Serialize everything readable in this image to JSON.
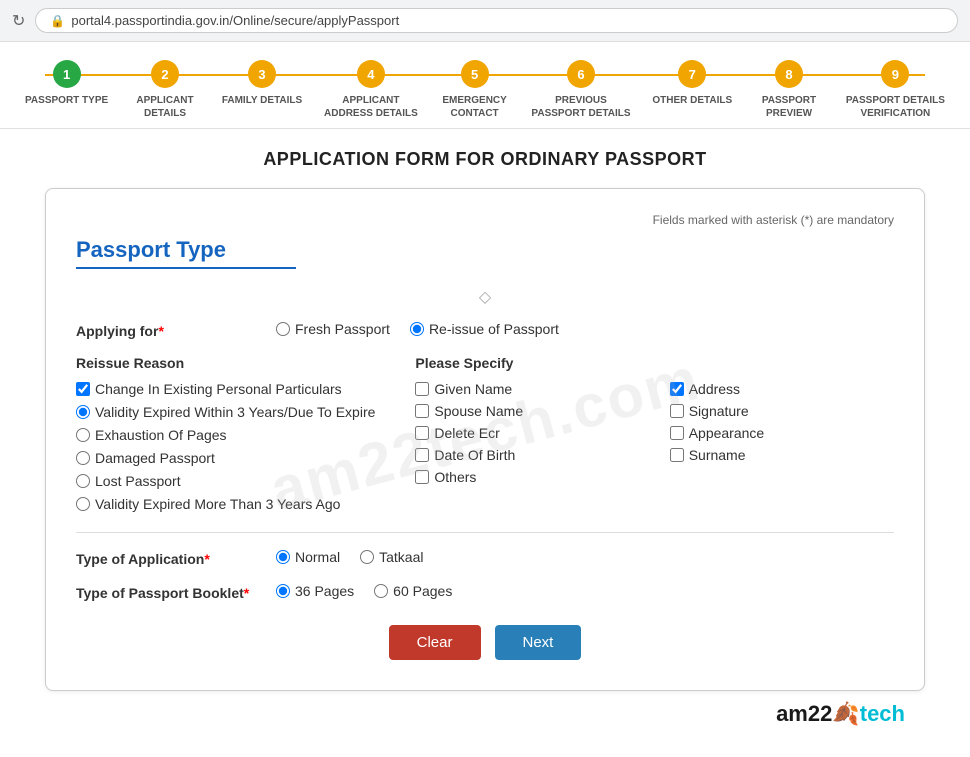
{
  "browser": {
    "url": "portal4.passportindia.gov.in/Online/secure/applyPassport"
  },
  "steps": [
    {
      "number": "1",
      "label": "PASSPORT TYPE",
      "state": "active"
    },
    {
      "number": "2",
      "label": "APPLICANT\nDETAILS",
      "state": "inactive"
    },
    {
      "number": "3",
      "label": "FAMILY DETAILS",
      "state": "inactive"
    },
    {
      "number": "4",
      "label": "APPLICANT\nADDRESS DETAILS",
      "state": "inactive"
    },
    {
      "number": "5",
      "label": "EMERGENCY\nCONTACT",
      "state": "inactive"
    },
    {
      "number": "6",
      "label": "PREVIOUS\nPASSPORT DETAILS",
      "state": "inactive"
    },
    {
      "number": "7",
      "label": "OTHER DETAILS",
      "state": "inactive"
    },
    {
      "number": "8",
      "label": "PASSPORT\nPREVIEW",
      "state": "inactive"
    },
    {
      "number": "9",
      "label": "PASSPORT DETAILS\nVERIFICATION",
      "state": "inactive"
    }
  ],
  "page_title": "APPLICATION FORM FOR ORDINARY PASSPORT",
  "mandatory_note": "Fields marked with asterisk (*) are mandatory",
  "section_title": "Passport Type",
  "applying_for_label": "Applying for",
  "applying_for_options": [
    {
      "label": "Fresh Passport",
      "value": "fresh",
      "checked": false
    },
    {
      "label": "Re-issue of Passport",
      "value": "reissue",
      "checked": true
    }
  ],
  "reissue_reason_title": "Reissue Reason",
  "reissue_reasons": [
    {
      "label": "Change In Existing Personal Particulars",
      "type": "checkbox",
      "checked": true
    },
    {
      "label": "Validity Expired Within 3 Years/Due To Expire",
      "type": "radio",
      "checked": true
    },
    {
      "label": "Exhaustion Of Pages",
      "type": "radio",
      "checked": false
    },
    {
      "label": "Damaged Passport",
      "type": "radio",
      "checked": false
    },
    {
      "label": "Lost Passport",
      "type": "radio",
      "checked": false
    },
    {
      "label": "Validity Expired More Than 3 Years Ago",
      "type": "radio",
      "checked": false
    }
  ],
  "please_specify_title": "Please Specify",
  "please_specify_items": [
    {
      "label": "Given Name",
      "checked": false,
      "col": 1
    },
    {
      "label": "Address",
      "checked": true,
      "col": 2
    },
    {
      "label": "Spouse Name",
      "checked": false,
      "col": 1
    },
    {
      "label": "Signature",
      "checked": false,
      "col": 2
    },
    {
      "label": "Delete Ecr",
      "checked": false,
      "col": 1
    },
    {
      "label": "Appearance",
      "checked": false,
      "col": 2
    },
    {
      "label": "Date Of Birth",
      "checked": false,
      "col": 1
    },
    {
      "label": "Surname",
      "checked": false,
      "col": 2
    },
    {
      "label": "Others",
      "checked": false,
      "col": 1
    }
  ],
  "type_of_application_label": "Type of Application",
  "application_type_options": [
    {
      "label": "Normal",
      "checked": true
    },
    {
      "label": "Tatkaal",
      "checked": false
    }
  ],
  "type_of_booklet_label": "Type of Passport Booklet",
  "booklet_options": [
    {
      "label": "36 Pages",
      "checked": true
    },
    {
      "label": "60 Pages",
      "checked": false
    }
  ],
  "buttons": {
    "clear": "Clear",
    "next": "Next"
  },
  "branding": {
    "text": "am22",
    "leaf": "🍂",
    "tech": "tech"
  }
}
